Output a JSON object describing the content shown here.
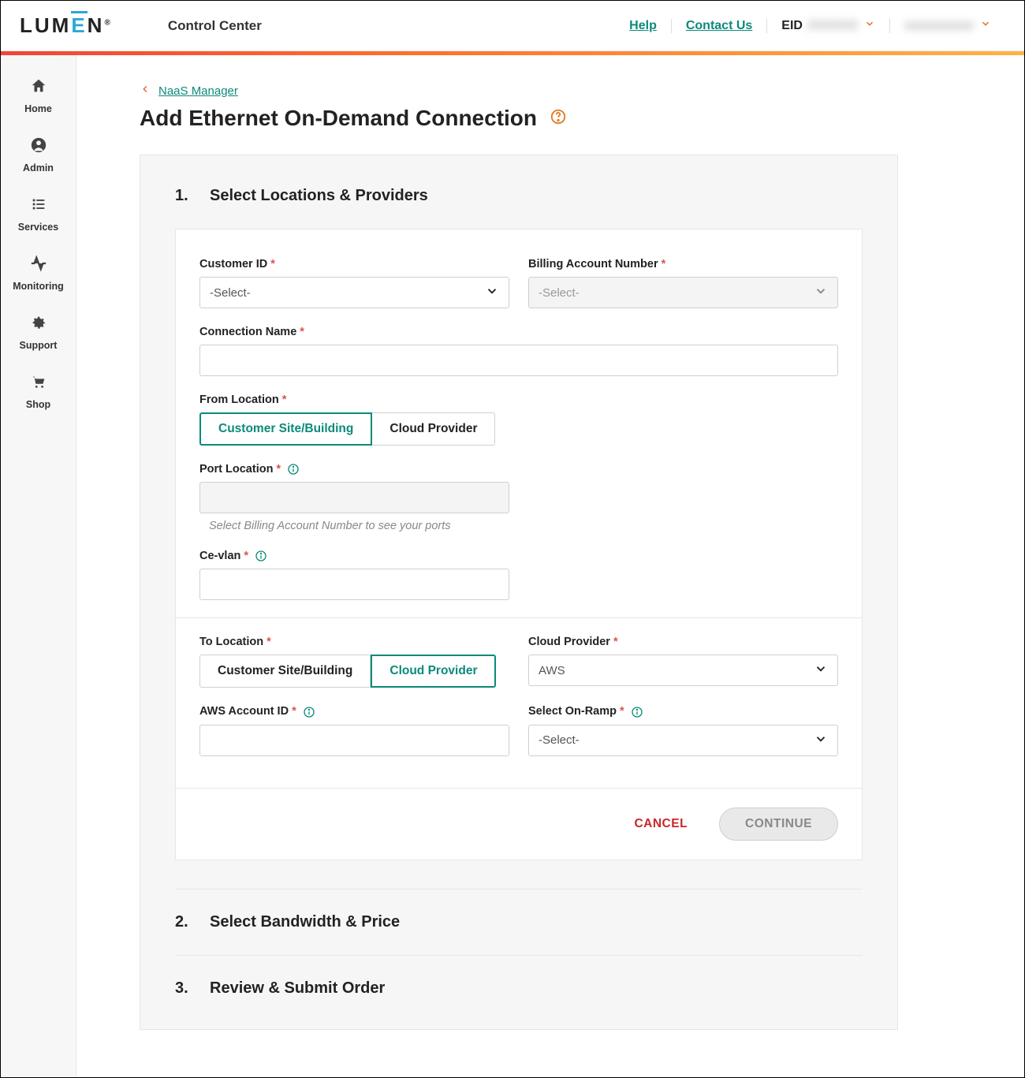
{
  "header": {
    "logo_text": "LUMEN",
    "app_title": "Control Center",
    "help": "Help",
    "contact": "Contact Us",
    "eid_label": "EID",
    "eid_value": "XXXXXX",
    "account_value": "xxxxxxxxxxx"
  },
  "sidebar": {
    "items": [
      {
        "label": "Home"
      },
      {
        "label": "Admin"
      },
      {
        "label": "Services"
      },
      {
        "label": "Monitoring"
      },
      {
        "label": "Support"
      },
      {
        "label": "Shop"
      }
    ]
  },
  "breadcrumb": {
    "back": "NaaS Manager"
  },
  "page": {
    "title": "Add Ethernet On-Demand Connection"
  },
  "steps": {
    "s1_num": "1.",
    "s1_title": "Select Locations & Providers",
    "s2_num": "2.",
    "s2_title": "Select Bandwidth & Price",
    "s3_num": "3.",
    "s3_title": "Review & Submit Order"
  },
  "form": {
    "customer_id_label": "Customer ID",
    "customer_id_value": "-Select-",
    "ban_label": "Billing Account Number",
    "ban_value": "-Select-",
    "conn_name_label": "Connection Name",
    "conn_name_value": "",
    "from_loc_label": "From Location",
    "from_opt_a": "Customer Site/Building",
    "from_opt_b": "Cloud Provider",
    "port_loc_label": "Port Location",
    "port_loc_helper": "Select Billing Account Number to see your ports",
    "cevlan_label": "Ce-vlan",
    "cevlan_value": "",
    "to_loc_label": "To Location",
    "to_opt_a": "Customer Site/Building",
    "to_opt_b": "Cloud Provider",
    "cloud_provider_label": "Cloud Provider",
    "cloud_provider_value": "AWS",
    "aws_id_label": "AWS Account ID",
    "aws_id_value": "",
    "onramp_label": "Select On-Ramp",
    "onramp_value": "-Select-"
  },
  "buttons": {
    "cancel": "CANCEL",
    "continue": "CONTINUE"
  }
}
